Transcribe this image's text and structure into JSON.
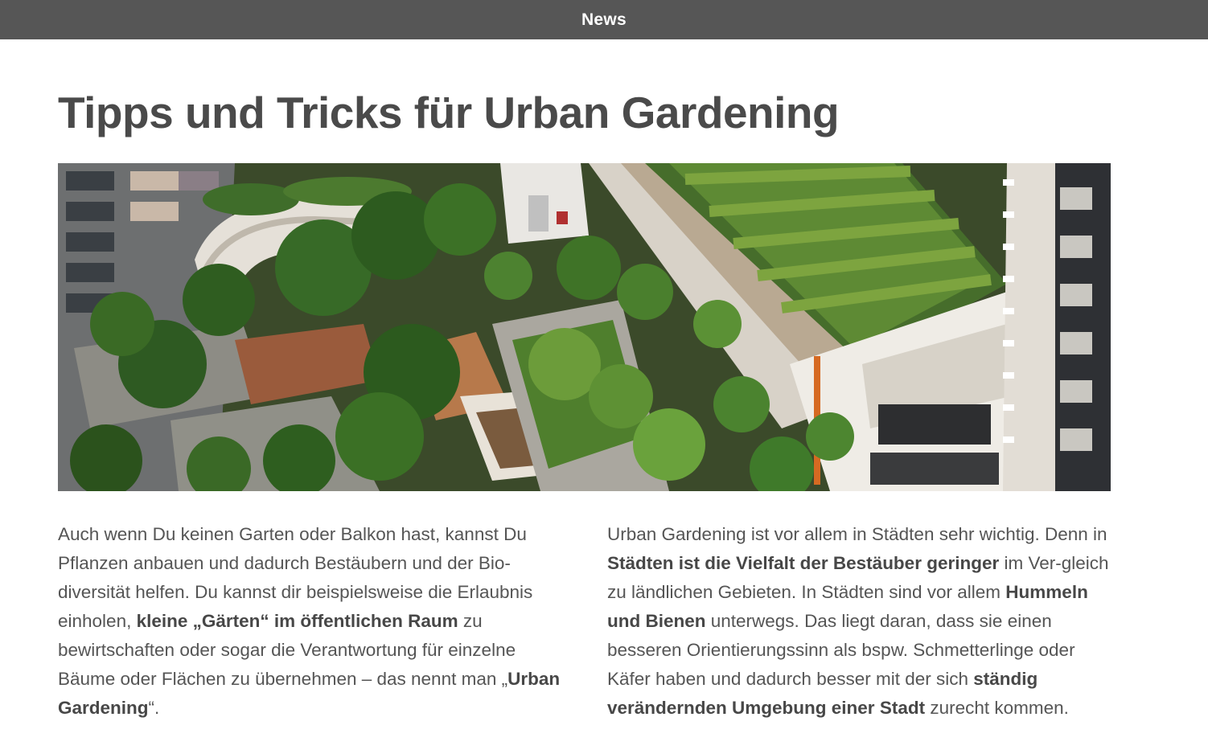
{
  "header": {
    "title": "News"
  },
  "article": {
    "title": "Tipps und Tricks für Urban Gardening",
    "image": {
      "icon": "rooftop-garden-photo"
    },
    "left_column": [
      {
        "text": "Auch wenn Du keinen Garten oder Balkon hast, kannst Du Pflanzen anbauen und dadurch Bestäubern und der Bio-diversität helfen. Du kannst dir beispielsweise die Erlaubnis einholen, ",
        "bold": false
      },
      {
        "text": "kleine „Gärten“ im öffentlichen Raum",
        "bold": true
      },
      {
        "text": " zu bewirtschaften oder sogar die Verantwortung für einzelne Bäume oder Flächen zu übernehmen – das nennt man „",
        "bold": false
      },
      {
        "text": "Urban Gardening",
        "bold": true
      },
      {
        "text": "“.",
        "bold": false
      }
    ],
    "right_column": [
      {
        "text": "Urban Gardening ist vor allem in Städten sehr wichtig. Denn in ",
        "bold": false
      },
      {
        "text": "Städten ist die Vielfalt der Bestäuber geringer",
        "bold": true
      },
      {
        "text": " im Ver-gleich zu ländlichen Gebieten. In Städten sind vor allem ",
        "bold": false
      },
      {
        "text": "Hummeln und Bienen",
        "bold": true
      },
      {
        "text": " unterwegs. Das liegt daran, dass sie einen besseren Orientierungssinn als bspw. Schmetterlinge oder Käfer haben und dadurch besser mit der sich ",
        "bold": false
      },
      {
        "text": "ständig verändernden Umgebung einer Stadt",
        "bold": true
      },
      {
        "text": " zurecht kommen.",
        "bold": false
      }
    ]
  }
}
